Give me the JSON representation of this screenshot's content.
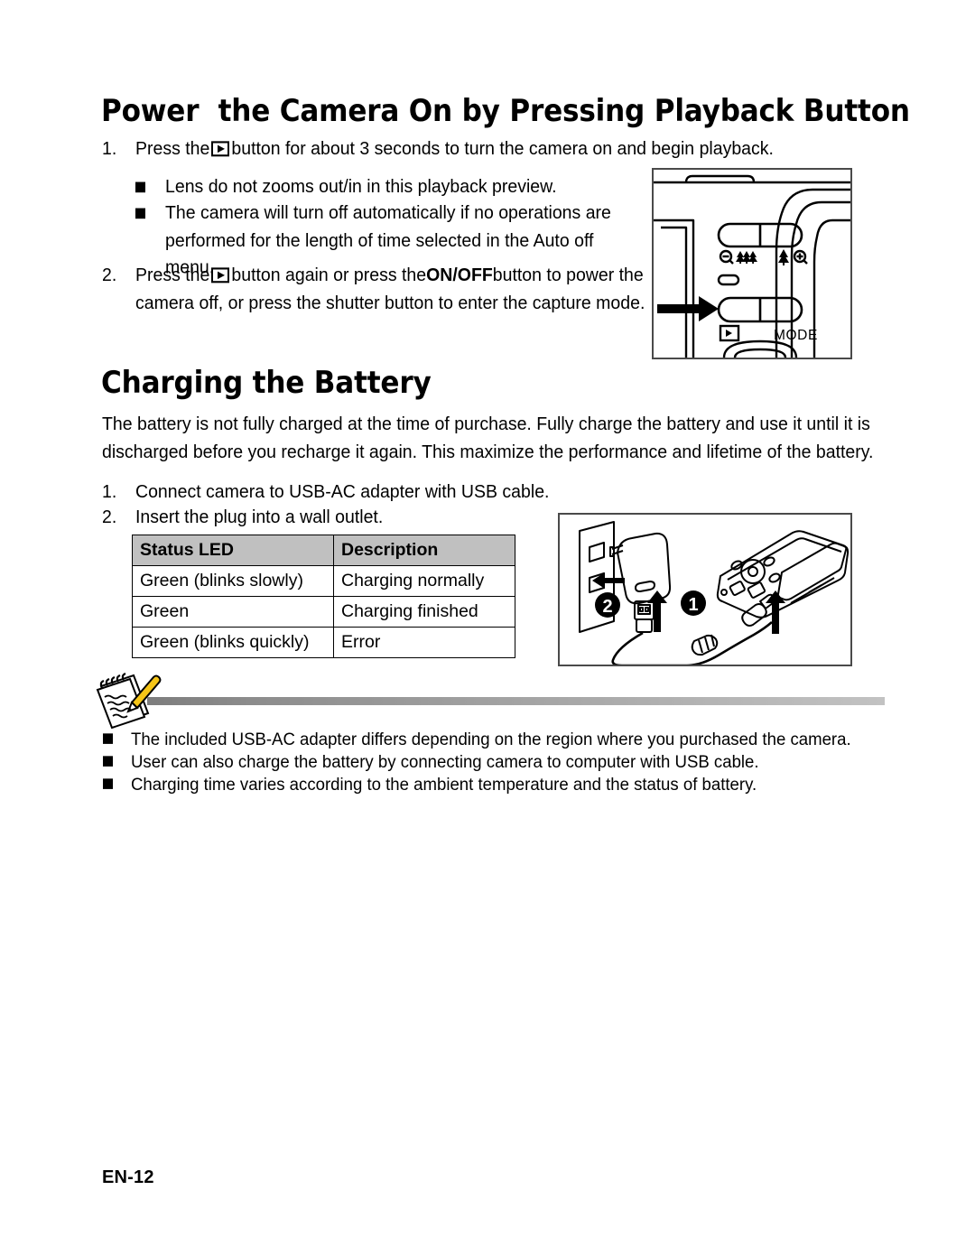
{
  "document": {
    "footer_page": "EN-12"
  },
  "section_playback": {
    "heading": "Power  the Camera On by Pressing Playback Button",
    "step1": {
      "number": "1.",
      "text_before_icon": "Press the",
      "icon": "playback-icon",
      "text_after_icon": "button for about 3 seconds to turn the camera on and begin playback."
    },
    "bullets": [
      "Lens do not zooms out/in in this playback preview.",
      "The camera will turn off automatically if no operations are performed for the length of time selected in the Auto off menu."
    ],
    "step2": {
      "number": "2.",
      "part1": "Press the",
      "icon": "playback-icon",
      "part2": "button again or press the",
      "emphasis": "ON/OFF",
      "part3": "button to power the camera off, or press the shutter button to enter the capture mode."
    }
  },
  "section_battery": {
    "heading": "Charging the Battery",
    "intro": "The battery is not fully charged at the time of purchase. Fully charge the battery and use it until it is discharged before you recharge it again. This maximize the performance and lifetime of the battery.",
    "steps": [
      {
        "number": "1.",
        "text": "Connect camera to USB-AC adapter with USB cable."
      },
      {
        "number": "2.",
        "text": "Insert the plug into a wall outlet."
      }
    ],
    "led_table": {
      "headers": [
        "Status LED",
        "Description"
      ],
      "rows": [
        [
          "Green (blinks slowly)",
          "Charging normally"
        ],
        [
          "Green",
          "Charging finished"
        ],
        [
          "Green (blinks quickly)",
          "Error"
        ]
      ]
    }
  },
  "notes": {
    "icon": "notepad-pencil-icon",
    "items": [
      "The included USB-AC adapter differs depending on the region where you purchased the camera.",
      "User can also charge the battery by connecting camera to computer with USB cable.",
      "Charging time varies according to the ambient temperature and the status of battery."
    ]
  },
  "camera_illustration": {
    "name": "camera-back-controls-diagram",
    "labels": {
      "mode": "MODE",
      "zoom_out": "zoom-out-icon",
      "wide": "wide-angle-icon",
      "tele": "tele-icon",
      "zoom_in": "zoom-in-icon",
      "playback": "playback-icon"
    }
  },
  "charging_illustration": {
    "name": "usb-ac-charging-diagram",
    "callouts": [
      "1",
      "2"
    ],
    "parts": [
      "wall-outlet",
      "usb-ac-adapter",
      "usb-cable",
      "camera"
    ]
  },
  "colors": {
    "table_header_bg": "#c0c0c0",
    "illustration_border": "#4a4a4a",
    "pencil_yellow": "#f5c518",
    "text": "#000000"
  }
}
